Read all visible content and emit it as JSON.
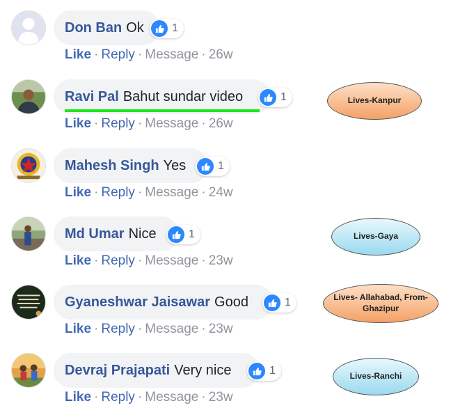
{
  "comments": [
    {
      "author": "Don Ban",
      "text": "Ok",
      "likes": "1",
      "actions": {
        "like": "Like",
        "reply": "Reply",
        "message": "Message",
        "time": "26w"
      },
      "avatar": "default-avatar"
    },
    {
      "author": "Ravi Pal",
      "text": "Bahut sundar video",
      "likes": "1",
      "actions": {
        "like": "Like",
        "reply": "Reply",
        "message": "Message",
        "time": "26w"
      },
      "avatar": "photo-outdoor"
    },
    {
      "author": "Mahesh Singh",
      "text": "Yes",
      "likes": "1",
      "actions": {
        "like": "Like",
        "reply": "Reply",
        "message": "Message",
        "time": "24w"
      },
      "avatar": "police-emblem"
    },
    {
      "author": "Md Umar",
      "text": "Nice",
      "likes": "1",
      "actions": {
        "like": "Like",
        "reply": "Reply",
        "message": "Message",
        "time": "23w"
      },
      "avatar": "photo-street"
    },
    {
      "author": "Gyaneshwar Jaisawar",
      "text": "Good",
      "likes": "1",
      "actions": {
        "like": "Like",
        "reply": "Reply",
        "message": "Message",
        "time": "23w"
      },
      "avatar": "quote-image"
    },
    {
      "author": "Devraj Prajapati",
      "text": "Very nice",
      "likes": "1",
      "actions": {
        "like": "Like",
        "reply": "Reply",
        "message": "Message",
        "time": "23w"
      },
      "avatar": "photo-children"
    }
  ],
  "separator": "·",
  "annotations": [
    {
      "text": "Lives-Kanpur",
      "color": "orange"
    },
    {
      "text": "Lives-Gaya",
      "color": "blue"
    },
    {
      "text": "Lives- Allahabad, From-Ghazipur",
      "color": "orange"
    },
    {
      "text": "Lives-Ranchi",
      "color": "blue"
    }
  ],
  "colors": {
    "author": "#365899",
    "link": "#4267b2",
    "muted": "#90949c",
    "bubble": "#f2f3f5",
    "like_badge": "#2d88ff",
    "highlight_underline": "#1ee81e"
  }
}
